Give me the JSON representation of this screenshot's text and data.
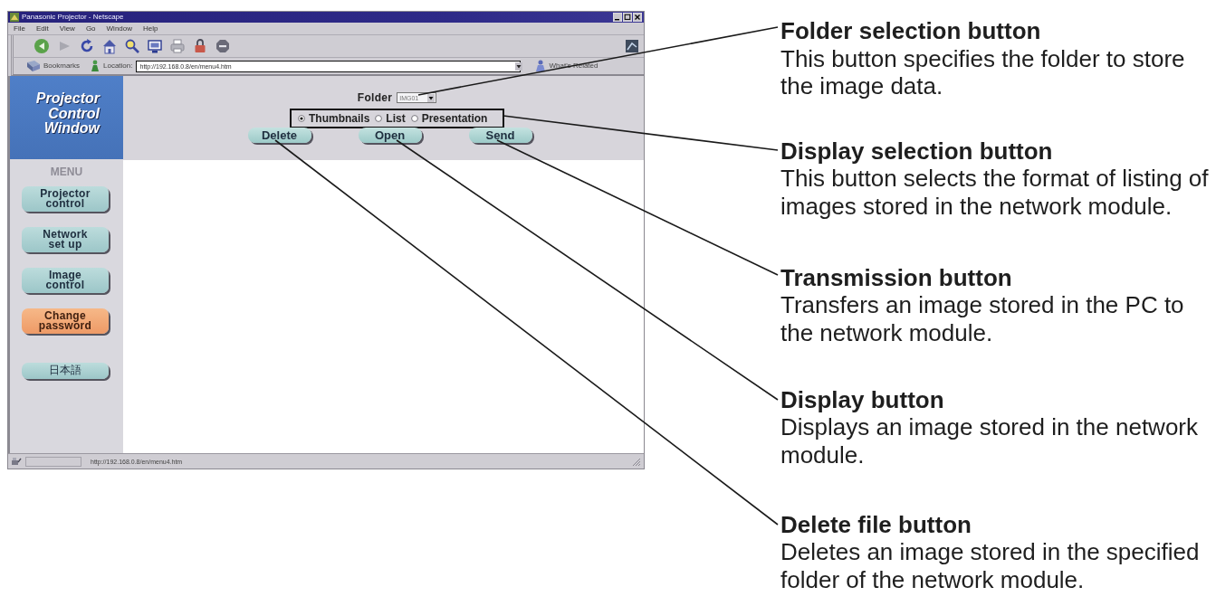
{
  "browser": {
    "title": "Panasonic Projector - Netscape",
    "menu": [
      "File",
      "Edit",
      "View",
      "Go",
      "Window",
      "Help"
    ],
    "bookmarks_label": "Bookmarks",
    "location_label": "Location:",
    "url": "http://192.168.0.8/en/menu4.htm",
    "related_label": "What's Related",
    "status_text": "http://192.168.0.8/en/menu4.htm"
  },
  "sidebar": {
    "logo": "Projector\nControl\nWindow",
    "menu_heading": "MENU",
    "items": [
      {
        "label": "Projector\ncontrol",
        "highlighted": false
      },
      {
        "label": "Network\nset up",
        "highlighted": false
      },
      {
        "label": "Image\ncontrol",
        "highlighted": false
      },
      {
        "label": "Change\npassword",
        "highlighted": true
      },
      {
        "label": "日本語",
        "highlighted": false
      }
    ]
  },
  "panel": {
    "folder_label": "Folder",
    "folder_value": "IMG01",
    "views": [
      {
        "label": "Thumbnails",
        "selected": true
      },
      {
        "label": "List",
        "selected": false
      },
      {
        "label": "Presentation",
        "selected": false
      }
    ],
    "buttons": [
      "Delete",
      "Open",
      "Send"
    ]
  },
  "annotations": [
    {
      "title": "Folder selection button",
      "text": "This button specifies the folder to store\nthe image data."
    },
    {
      "title": "Display selection button",
      "text": "This button selects the format of listing of\nimages stored in the network module."
    },
    {
      "title": "Transmission button",
      "text": "Transfers an image stored in the PC to\nthe network module."
    },
    {
      "title": "Display button",
      "text": "Displays an image stored in the network\nmodule."
    },
    {
      "title": "Delete file button",
      "text": "Deletes an image stored in the specified\nfolder of the network module."
    }
  ]
}
